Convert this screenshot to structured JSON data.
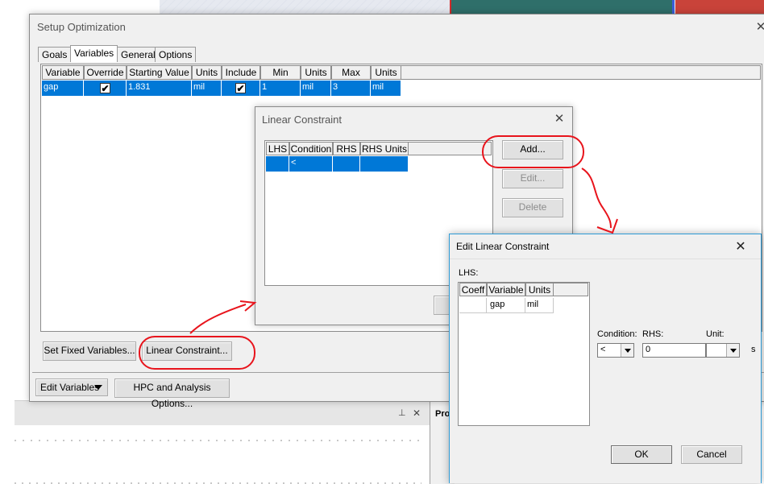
{
  "setup_optimization": {
    "title": "Setup Optimization",
    "tabs": [
      "Goals",
      "Variables",
      "General",
      "Options"
    ],
    "columns": [
      "Variable",
      "Override",
      "Starting Value",
      "Units",
      "Include",
      "Min",
      "Units",
      "Max",
      "Units"
    ],
    "row": {
      "variable": "gap",
      "override": "✔",
      "starting_value": "1.831",
      "units1": "mil",
      "include": "✔",
      "min": "1",
      "units2": "mil",
      "max": "3",
      "units3": "mil"
    },
    "set_fixed_variables": "Set Fixed Variables...",
    "linear_constraint": "Linear Constraint...",
    "edit_variables": "Edit Variables",
    "hpc_options": "HPC and Analysis Options..."
  },
  "linear_constraint_dialog": {
    "title": "Linear Constraint",
    "columns": [
      "LHS",
      "Condition",
      "RHS",
      "RHS Units"
    ],
    "row": {
      "lhs": "",
      "condition": "<",
      "rhs": "",
      "rhs_units": ""
    },
    "add": "Add...",
    "edit": "Edit...",
    "delete": "Delete"
  },
  "edit_linear_constraint": {
    "title": "Edit Linear Constraint",
    "lhs_label": "LHS:",
    "columns": [
      "Coeff",
      "Variable",
      "Units"
    ],
    "row": {
      "coeff": "",
      "variable": "gap",
      "units": "mil"
    },
    "condition_label": "Condition:",
    "condition_value": "<",
    "rhs_label": "RHS:",
    "rhs_value": "0",
    "unit_label": "Unit:",
    "unit_value": "",
    "ok": "OK",
    "cancel": "Cancel"
  },
  "background": {
    "pane_label": "Pro",
    "pin": "📌",
    "close": "✕",
    "edge_char": "s"
  },
  "colors": {
    "selection": "#0078d7",
    "annotation": "#e8141c"
  }
}
